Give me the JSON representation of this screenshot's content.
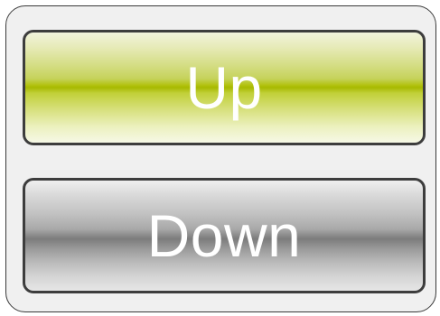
{
  "buttons": {
    "up_label": "Up",
    "down_label": "Down"
  },
  "colors": {
    "panel_background": "#f0f0f0",
    "panel_border": "#3a3a3a",
    "up_accent": "#a7b900",
    "down_accent": "#7c7c7c",
    "label_text": "#ffffff"
  }
}
